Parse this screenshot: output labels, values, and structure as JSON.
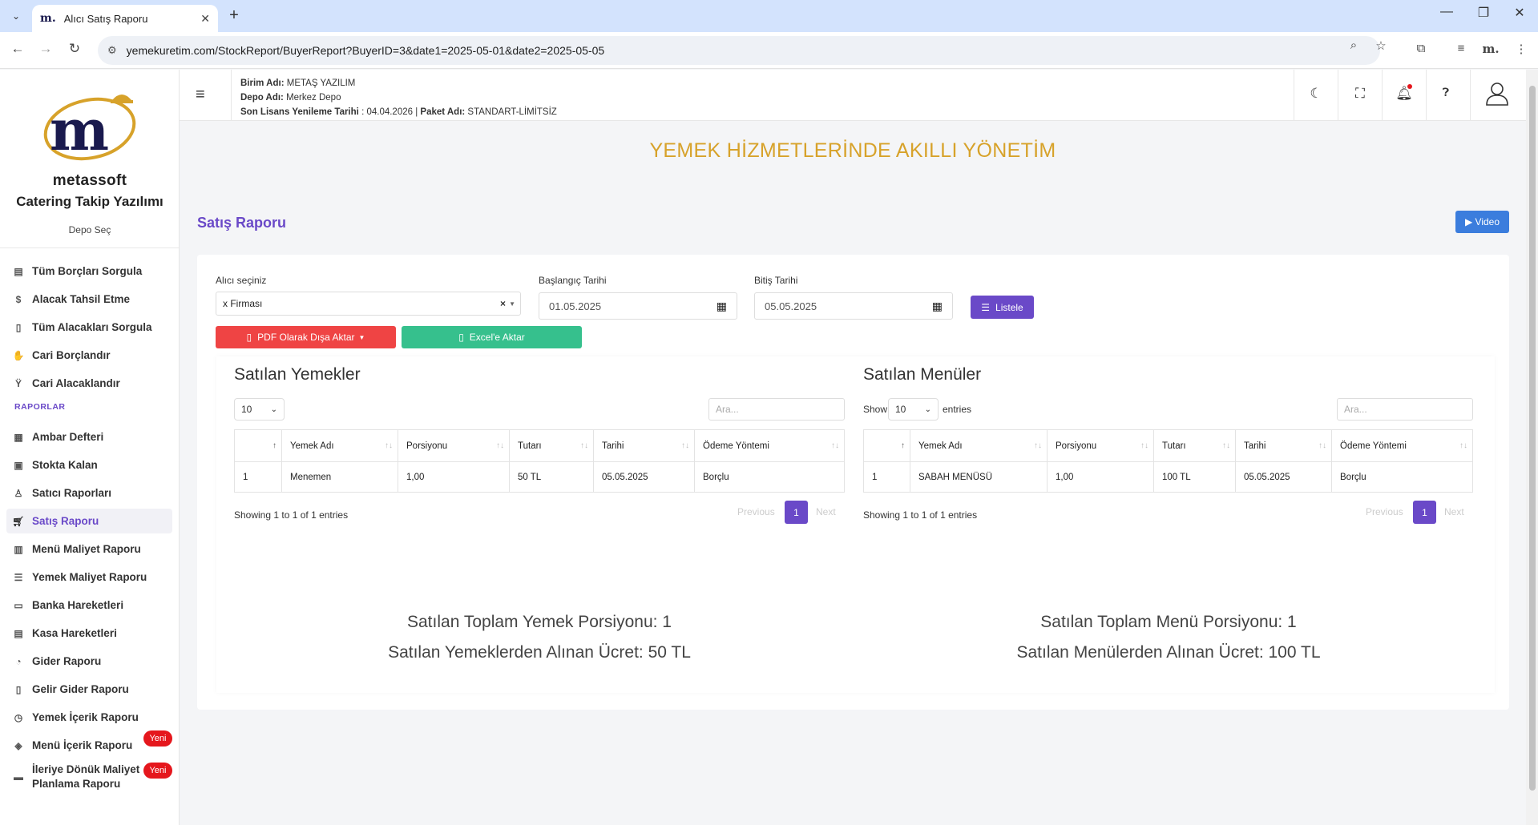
{
  "browser": {
    "tab_title": "Alıcı Satış Raporu",
    "favicon_text": "m.",
    "url": "yemekuretim.com/StockReport/BuyerReport?BuyerID=3&date1=2025-05-01&date2=2025-05-05"
  },
  "sidebar": {
    "brand": "metassoft",
    "app_name": "Catering Takip Yazılımı",
    "depot_select": "Depo Seç",
    "items_top": [
      {
        "label": "Tüm Borçları Sorgula",
        "icon": "report-icon"
      },
      {
        "label": "Alacak Tahsil Etme",
        "icon": "coins-icon"
      },
      {
        "label": "Tüm Alacakları Sorgula",
        "icon": "document-icon"
      },
      {
        "label": "Cari Borçlandır",
        "icon": "hand-money-icon"
      },
      {
        "label": "Cari Alacaklandır",
        "icon": "person-icon"
      }
    ],
    "section_reports": "RAPORLAR",
    "items_reports": [
      {
        "label": "Ambar Defteri",
        "icon": "book-icon"
      },
      {
        "label": "Stokta Kalan",
        "icon": "box-icon"
      },
      {
        "label": "Satıcı Raporları",
        "icon": "seller-icon"
      },
      {
        "label": "Satış Raporu",
        "icon": "cart-icon"
      },
      {
        "label": "Menü Maliyet Raporu",
        "icon": "table-icon"
      },
      {
        "label": "Yemek Maliyet Raporu",
        "icon": "list-icon"
      },
      {
        "label": "Banka Hareketleri",
        "icon": "bank-icon"
      },
      {
        "label": "Kasa Hareketleri",
        "icon": "cash-icon"
      },
      {
        "label": "Gider Raporu",
        "icon": "expense-icon"
      },
      {
        "label": "Gelir Gider Raporu",
        "icon": "ledger-icon"
      },
      {
        "label": "Yemek İçerik Raporu",
        "icon": "recipe-icon"
      },
      {
        "label": "Menü İçerik Raporu",
        "icon": "menu-icon"
      },
      {
        "label": "İleriye Dönük Maliyet Planlama Raporu",
        "icon": "plan-icon"
      }
    ],
    "new_badge": "Yeni"
  },
  "header": {
    "unit_label": "Birim Adı:",
    "unit_value": "METAŞ YAZILIM",
    "depot_label": "Depo Adı:",
    "depot_value": "Merkez Depo",
    "license_label": "Son Lisans Yenileme Tarihi",
    "license_value": ": 04.04.2026 |",
    "package_label": "Paket Adı:",
    "package_value": "STANDART-LİMİTSİZ"
  },
  "main": {
    "slogan": "YEMEK HİZMETLERİNDE AKILLI YÖNETİM",
    "page_title": "Satış Raporu",
    "video_button": "▶ Video",
    "buyer_label": "Alıcı seçiniz",
    "buyer_value": "x Firması",
    "start_label": "Başlangıç Tarihi",
    "start_value": "01.05.2025",
    "end_label": "Bitiş Tarihi",
    "end_value": "05.05.2025",
    "list_button": "Listele",
    "pdf_button": "PDF Olarak Dışa Aktar",
    "excel_button": "Excel'e Aktar"
  },
  "foods_table": {
    "title": "Satılan Yemekler",
    "page_length": "10",
    "search_placeholder": "Ara...",
    "columns": [
      "",
      "Yemek Adı",
      "Porsiyonu",
      "Tutarı",
      "Tarihi",
      "Ödeme Yöntemi"
    ],
    "rows": [
      [
        "1",
        "Menemen",
        "1,00",
        "50 TL",
        "05.05.2025",
        "Borçlu"
      ]
    ],
    "info": "Showing 1 to 1 of 1 entries",
    "prev": "Previous",
    "page": "1",
    "next": "Next"
  },
  "menus_table": {
    "title": "Satılan Menüler",
    "show_label": "Show",
    "page_length": "10",
    "entries_label": "entries",
    "search_placeholder": "Ara...",
    "columns": [
      "",
      "Yemek Adı",
      "Porsiyonu",
      "Tutarı",
      "Tarihi",
      "Ödeme Yöntemi"
    ],
    "rows": [
      [
        "1",
        "SABAH MENÜSÜ",
        "1,00",
        "100 TL",
        "05.05.2025",
        "Borçlu"
      ]
    ],
    "info": "Showing 1 to 1 of 1 entries",
    "prev": "Previous",
    "page": "1",
    "next": "Next"
  },
  "summary": {
    "food_portions": "Satılan Toplam Yemek Porsiyonu: 1",
    "food_income": "Satılan Yemeklerden Alınan Ücret: 50 TL",
    "menu_portions": "Satılan Toplam Menü Porsiyonu: 1",
    "menu_income": "Satılan Menülerden Alınan Ücret: 100 TL"
  },
  "colors": {
    "accent": "#6a49c8",
    "slogan": "#d7a22a",
    "danger": "#ef4444",
    "success": "#36c08d",
    "primary": "#3b7ddd",
    "badge": "#e5171d"
  }
}
